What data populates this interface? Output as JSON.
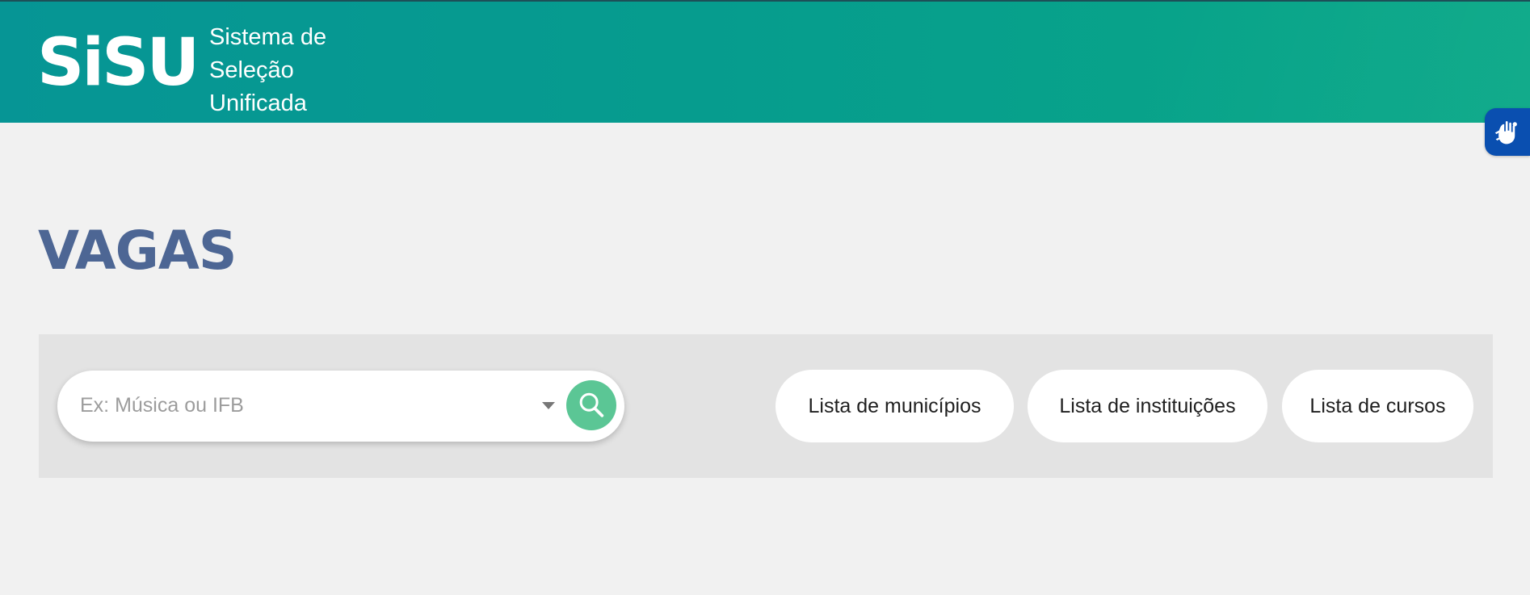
{
  "header": {
    "logo": "SiSU",
    "subtitle_lines": [
      "Sistema de",
      "Seleção",
      "Unificada"
    ]
  },
  "page": {
    "title": "VAGAS"
  },
  "search": {
    "placeholder": "Ex: Música ou IFB",
    "search_icon": "search-icon",
    "dropdown_icon": "chevron-down-icon"
  },
  "lists": [
    {
      "label": "Lista de municípios"
    },
    {
      "label": "Lista de instituições"
    },
    {
      "label": "Lista de cursos"
    }
  ],
  "accessibility": {
    "icon": "sign-language-icon"
  },
  "colors": {
    "header_gradient_start": "#069595",
    "header_gradient_end": "#09a887",
    "title": "#4d6694",
    "search_button": "#5bc695",
    "accessibility_button": "#0a4fb0"
  }
}
